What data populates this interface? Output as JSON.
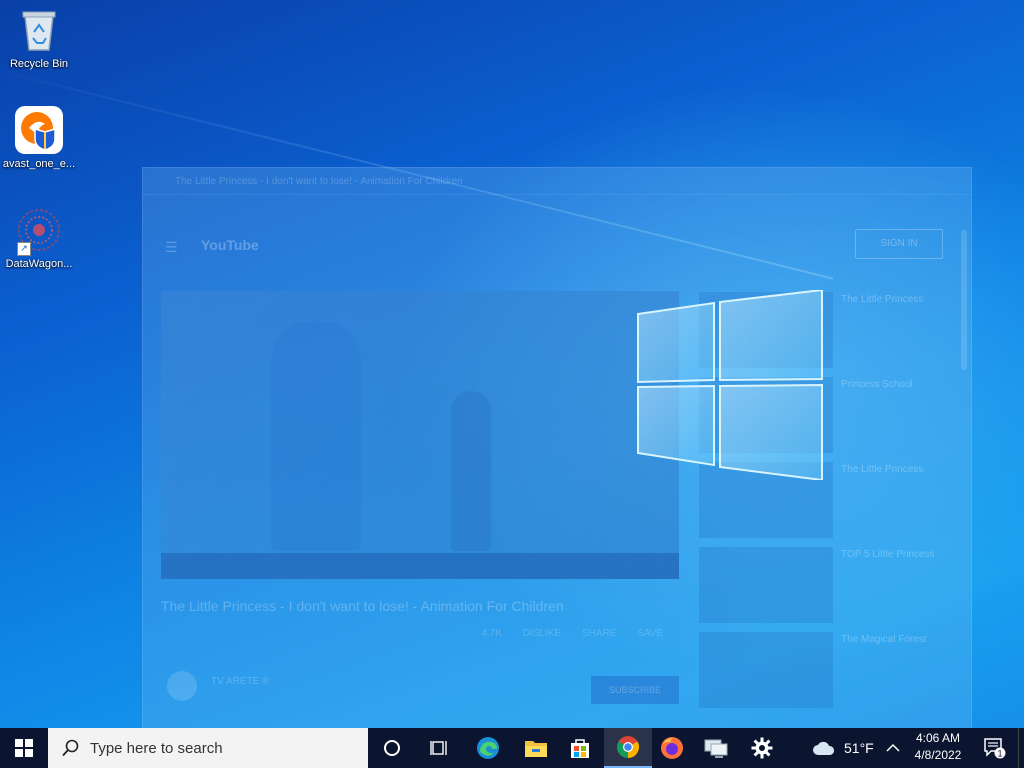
{
  "desktop": {
    "icons": [
      {
        "label": "Recycle Bin",
        "icon": "recycle-bin-icon"
      },
      {
        "label": "avast_one_e...",
        "icon": "avast-one-icon"
      },
      {
        "label": "DataWagon...",
        "icon": "datawagon-icon"
      }
    ]
  },
  "background_window": {
    "site": "YouTube",
    "sign_in": "SIGN IN",
    "video_title": "The Little Princess - I don't want to lose! - Animation For Children",
    "actions": [
      "4.7K",
      "DISLIKE",
      "SHARE",
      "SAVE"
    ],
    "channel": "TV ARETE ®",
    "subscribe": "SUBSCRIBE",
    "related": [
      {
        "title": "The Little Princess"
      },
      {
        "title": "Princess School"
      },
      {
        "title": "The Little Princess"
      },
      {
        "title": "TOP 5 Little Princess"
      },
      {
        "title": "The Magical Forest"
      }
    ]
  },
  "taskbar": {
    "search_placeholder": "Type here to search",
    "apps": [
      "cortana",
      "task-view",
      "edge",
      "file-explorer",
      "microsoft-store",
      "chrome",
      "firefox",
      "remote-desktop",
      "settings"
    ],
    "active_app": "chrome",
    "weather": {
      "temp": "51°F",
      "icon": "cloud-icon"
    },
    "clock": {
      "time": "4:06 AM",
      "date": "4/8/2022"
    },
    "notifications_count": "1"
  },
  "colors": {
    "taskbar": "#0b1530",
    "search_box": "#f3f3f3",
    "desktop_accent": "#0e86e6"
  }
}
